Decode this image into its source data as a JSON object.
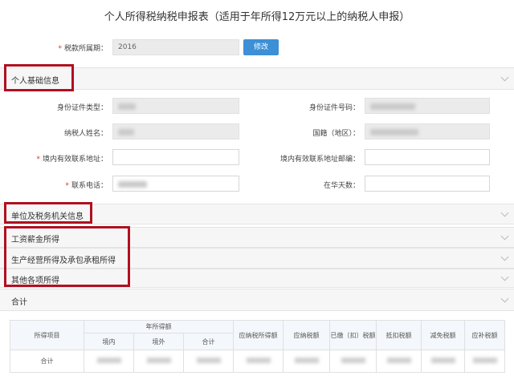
{
  "page_title": "个人所得税纳税申报表（适用于年所得12万元以上的纳税人申报）",
  "tax_period": {
    "label": "税款所属期：",
    "value": "2016",
    "button": "修改"
  },
  "sections": {
    "basic": "个人基础信息",
    "unit": "单位及税务机关信息",
    "salary": "工资薪金所得",
    "business": "生产经营所得及承包承租所得",
    "other": "其他各项所得",
    "total": "合计"
  },
  "fields": {
    "id_type": "身份证件类型：",
    "id_number": "身份证件号码：",
    "name": "纳税人姓名：",
    "nationality": "国籍（地区）：",
    "address": "境内有效联系地址：",
    "postcode": "境内有效联系地址邮编：",
    "phone": "联系电话：",
    "days": "在华天数："
  },
  "table": {
    "headers": [
      "所得项目",
      "年所得额",
      "应纳税所得额",
      "应纳税额",
      "已缴（扣）税额",
      "抵扣税额",
      "减免税额",
      "应补税额"
    ],
    "sub_headers": [
      "境内",
      "境外",
      "合计"
    ],
    "row_label": "合计"
  },
  "colors": {
    "required": "#e03030",
    "button": "#3d8fd6",
    "highlight": "#b01020"
  }
}
